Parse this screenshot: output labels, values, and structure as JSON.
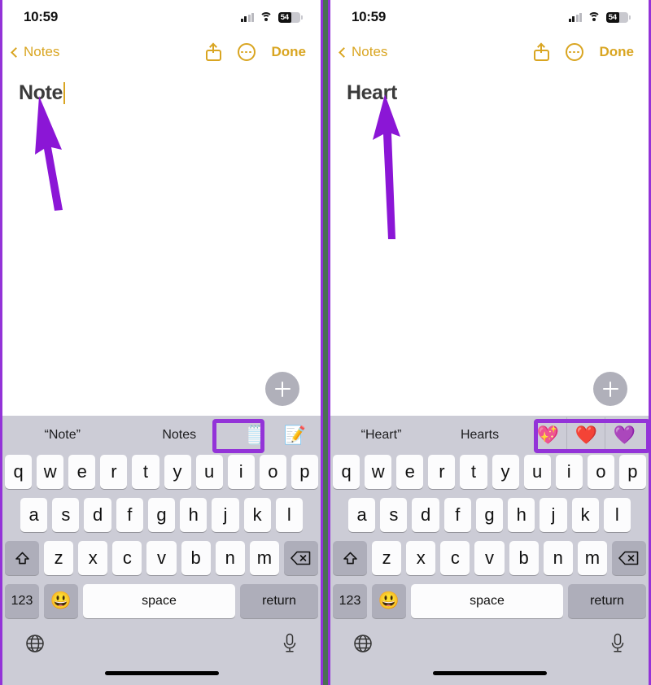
{
  "meta": {
    "accent_purple": "#9333d8",
    "divider_green": "#4a7052",
    "notes_gold": "#d9a521",
    "keyboard_bg": "#ccccd6",
    "key_white": "#fcfcfd",
    "key_dark": "#aeaeba",
    "fab_gray": "#b0b0ba"
  },
  "statusbar": {
    "time": "10:59",
    "battery_percent": "54",
    "cellular_icon": "signal-bars-icon",
    "wifi_icon": "wifi-icon",
    "battery_icon": "battery-icon"
  },
  "navbar": {
    "back_label": "Notes",
    "back_icon": "chevron-left-icon",
    "share_icon": "share-icon",
    "more_icon": "more-circle-icon",
    "done_label": "Done"
  },
  "panels": [
    {
      "id": "left",
      "note_title": "Note",
      "has_caret": true,
      "predictions": [
        "“Note”",
        "Notes"
      ],
      "emoji_suggestions": [
        "🗒️",
        "📝"
      ],
      "highlighted_emoji_count": 1,
      "fab_icon": "add-note-icon"
    },
    {
      "id": "right",
      "note_title": "Heart",
      "has_caret": false,
      "predictions": [
        "“Heart”",
        "Hearts"
      ],
      "emoji_suggestions": [
        "💖",
        "❤️",
        "💜"
      ],
      "highlighted_emoji_count": 3,
      "fab_icon": "add-note-icon"
    }
  ],
  "keyboard": {
    "row1": [
      "q",
      "w",
      "e",
      "r",
      "t",
      "y",
      "u",
      "i",
      "o",
      "p"
    ],
    "row2": [
      "a",
      "s",
      "d",
      "f",
      "g",
      "h",
      "j",
      "k",
      "l"
    ],
    "row3": [
      "z",
      "x",
      "c",
      "v",
      "b",
      "n",
      "m"
    ],
    "shift_icon": "shift-icon",
    "delete_icon": "backspace-icon",
    "numbers_label": "123",
    "emoji_label": "😃",
    "space_label": "space",
    "return_label": "return",
    "globe_icon": "globe-icon",
    "mic_icon": "microphone-icon"
  }
}
